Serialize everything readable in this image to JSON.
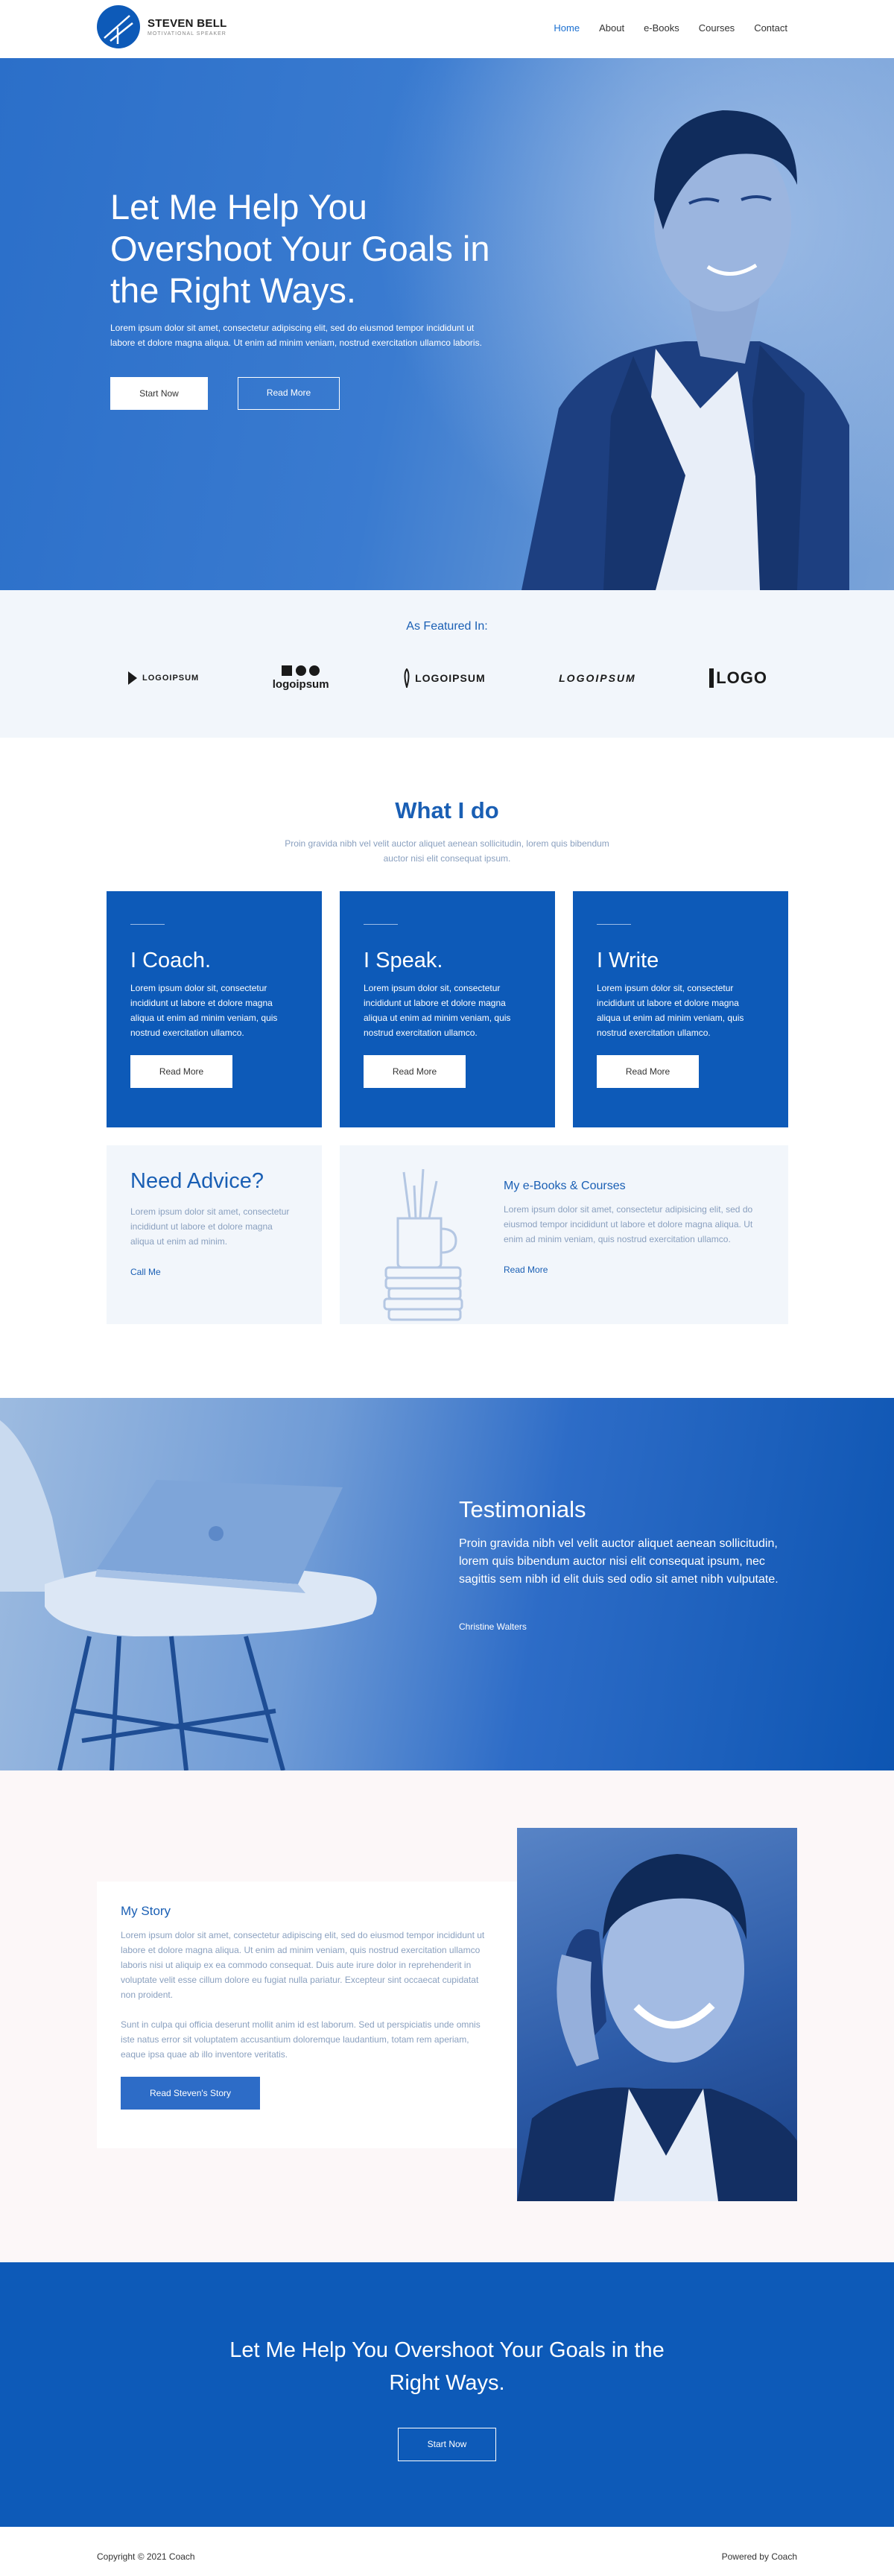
{
  "brand": {
    "name": "STEVEN BELL",
    "tagline": "MOTIVATIONAL SPEAKER"
  },
  "nav": [
    {
      "label": "Home"
    },
    {
      "label": "About"
    },
    {
      "label": "e-Books"
    },
    {
      "label": "Courses"
    },
    {
      "label": "Contact"
    }
  ],
  "hero": {
    "title": "Let Me Help You Overshoot Your Goals in the Right Ways.",
    "text": "Lorem ipsum dolor sit amet, consectetur adipiscing elit, sed do eiusmod tempor incididunt ut labore et dolore magna aliqua. Ut enim ad minim veniam, nostrud exercitation ullamco laboris.",
    "btn_primary": "Start Now",
    "btn_secondary": "Read More"
  },
  "featured": {
    "title": "As Featured In:",
    "logos": [
      "LOGOIPSUM",
      "logoipsum",
      "LOGOIPSUM",
      "LOGOIPSUM",
      "LOGO"
    ]
  },
  "what": {
    "title": "What I do",
    "subtitle": "Proin gravida nibh vel velit auctor aliquet aenean sollicitudin, lorem quis bibendum auctor nisi elit consequat ipsum.",
    "cards": [
      {
        "title": "I Coach.",
        "text": "Lorem ipsum dolor sit, consectetur incididunt ut labore et dolore magna aliqua ut enim ad minim veniam, quis nostrud exercitation ullamco.",
        "button": "Read More"
      },
      {
        "title": "I Speak.",
        "text": "Lorem ipsum dolor sit, consectetur incididunt ut labore et dolore magna aliqua ut enim ad minim veniam, quis nostrud exercitation ullamco.",
        "button": "Read More"
      },
      {
        "title": "I Write",
        "text": "Lorem ipsum dolor sit, consectetur incididunt ut labore et dolore magna aliqua ut enim ad minim veniam, quis nostrud exercitation ullamco.",
        "button": "Read More"
      }
    ],
    "advice": {
      "title": "Need Advice?",
      "text": "Lorem ipsum dolor sit amet, consectetur incididunt ut labore et dolore magna aliqua ut enim ad minim.",
      "link": "Call Me"
    },
    "ebooks": {
      "title": "My e-Books & Courses",
      "text": "Lorem ipsum dolor sit amet, consectetur adipisicing elit, sed do eiusmod tempor incididunt ut labore et dolore magna aliqua. Ut enim ad minim veniam, quis nostrud exercitation ullamco.",
      "link": "Read More"
    }
  },
  "testimonials": {
    "title": "Testimonials",
    "text": "Proin gravida nibh vel velit auctor aliquet aenean sollicitudin, lorem quis bibendum auctor nisi elit consequat ipsum, nec sagittis sem nibh id elit duis sed odio sit amet nibh vulputate.",
    "author": "Christine Walters"
  },
  "story": {
    "title": "My Story",
    "p1": "Lorem ipsum dolor sit amet, consectetur adipiscing elit, sed do eiusmod tempor incididunt ut labore et dolore magna aliqua. Ut enim ad minim veniam, quis nostrud exercitation ullamco laboris nisi ut aliquip ex ea commodo consequat. Duis aute irure dolor in reprehenderit in voluptate velit esse cillum dolore eu fugiat nulla pariatur. Excepteur sint occaecat cupidatat non proident.",
    "p2": "Sunt in culpa qui officia deserunt mollit anim id est laborum. Sed ut perspiciatis unde omnis iste natus error sit voluptatem accusantium doloremque laudantium, totam rem aperiam, eaque ipsa quae ab illo inventore veritatis.",
    "button": "Read Steven's Story"
  },
  "cta": {
    "title": "Let Me Help You Overshoot Your Goals in the Right Ways.",
    "button": "Start Now"
  },
  "footer": {
    "copyright": "Copyright © 2021 Coach",
    "powered": "Powered by Coach"
  }
}
